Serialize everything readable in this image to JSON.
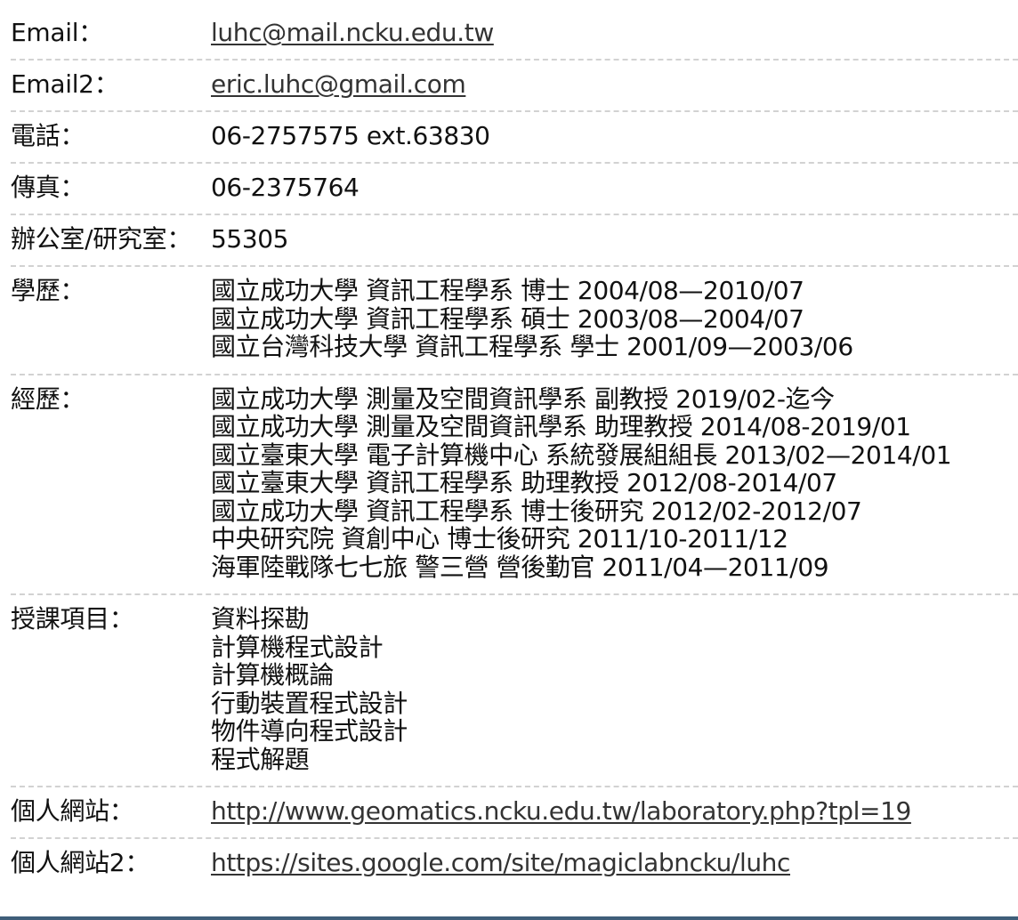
{
  "rows": [
    {
      "label": "Email：",
      "value": "luhc@mail.ncku.edu.tw"
    },
    {
      "label": "Email2：",
      "value": "eric.luhc@gmail.com"
    },
    {
      "label": "電話：",
      "value": "06-2757575 ext.63830"
    },
    {
      "label": "傳真：",
      "value": "06-2375764"
    },
    {
      "label": "辦公室/研究室：",
      "value": "55305"
    }
  ],
  "education": {
    "label": "學歷：",
    "items": [
      "國立成功大學 資訊工程學系 博士 2004/08—2010/07",
      "國立成功大學 資訊工程學系 碩士 2003/08—2004/07",
      "國立台灣科技大學 資訊工程學系 學士 2001/09—2003/06"
    ]
  },
  "experience": {
    "label": "經歷：",
    "items": [
      "國立成功大學 測量及空間資訊學系 副教授 2019/02-迄今",
      "國立成功大學 測量及空間資訊學系 助理教授 2014/08-2019/01",
      "國立臺東大學 電子計算機中心 系統發展組組長 2013/02—2014/01",
      "國立臺東大學 資訊工程學系 助理教授 2012/08-2014/07",
      "國立成功大學 資訊工程學系 博士後研究 2012/02-2012/07",
      "中央研究院 資創中心 博士後研究 2011/10-2011/12",
      "海軍陸戰隊七七旅 警三營 營後勤官 2011/04—2011/09"
    ]
  },
  "courses": {
    "label": "授課項目：",
    "items": [
      "資料探勘",
      "計算機程式設計",
      "計算機概論",
      "行動裝置程式設計",
      "物件導向程式設計",
      "程式解題"
    ]
  },
  "websites": [
    {
      "label": "個人網站：",
      "value": "http://www.geomatics.ncku.edu.tw/laboratory.php?tpl=19"
    },
    {
      "label": "個人網站2：",
      "value": "https://sites.google.com/site/magiclabncku/luhc"
    }
  ],
  "colors": {
    "text": "#111111",
    "link": "#333333",
    "divider": "#d2d2d2",
    "bottom_strip": "#3f5e79"
  }
}
